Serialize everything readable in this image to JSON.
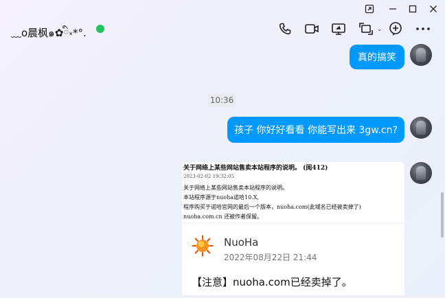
{
  "window": {
    "buttons": [
      "pin-icon",
      "minimize-icon",
      "maximize-icon",
      "close-icon"
    ]
  },
  "header": {
    "contact_name": "﹏o晨枫๑✿ི༝*°.",
    "status_color": "#21c45f",
    "actions": [
      "phone-icon",
      "video-call-icon",
      "screen-share-icon",
      "remote-assist-icon",
      "add-contact-icon",
      "more-icon"
    ]
  },
  "messages": {
    "msg1": "真的搞笑",
    "time": "10:36",
    "msg2": "孩子 你好好看看  你能写出来 3gw.cn?"
  },
  "card": {
    "shot_title": "关于网络上某些网站售卖本站程序的说明。 (阅412)",
    "shot_date": "2023-02-02 19:32:05",
    "shot_lines": [
      "关于网络上某些网站售卖本站程序的说明。",
      "本站程序源于nuoha诺哈10.X,",
      "程序购买于诺哈官网的最后一个版本，nuoha.com(此域名已经被卖掉了)",
      "nuoha.com.cn 还被作者保留。"
    ],
    "site_name": "NuoHa",
    "site_date": "2022年08月22日 21:44",
    "notice": "【注意】nuoha.com已经卖掉了。"
  },
  "colors": {
    "bubble": "#0099ff",
    "accent_green": "#21c45f"
  }
}
